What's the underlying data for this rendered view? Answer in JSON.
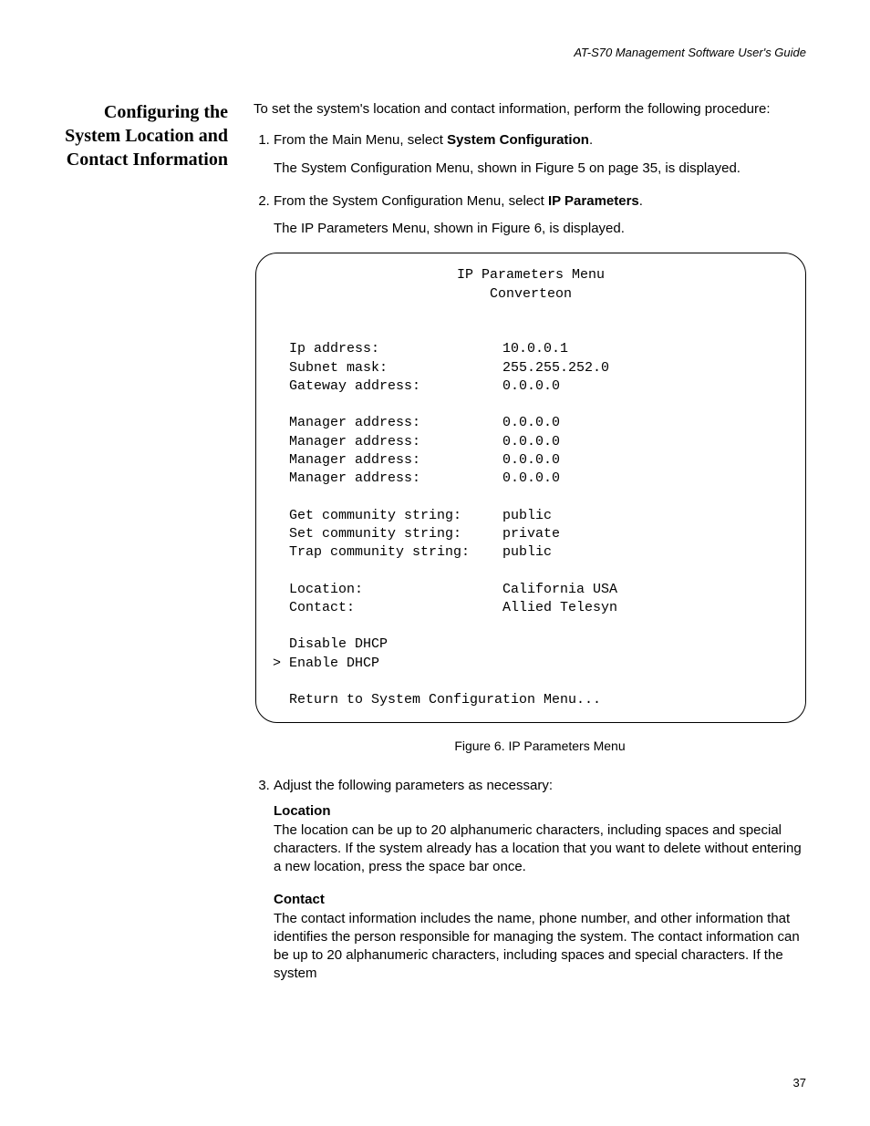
{
  "header": "AT-S70 Management Software User's Guide",
  "side_heading": "Configuring the System Location and Contact Information",
  "intro": "To set the system's location and contact information, perform the following procedure:",
  "steps": {
    "s1_pre": "From the Main Menu, select ",
    "s1_bold": "System Configuration",
    "s1_post": ".",
    "s1_detail": "The System Configuration Menu, shown in Figure 5 on page 35, is displayed.",
    "s2_pre": "From the System Configuration Menu, select ",
    "s2_bold": "IP Parameters",
    "s2_post": ".",
    "s2_detail": "The IP Parameters Menu, shown in Figure 6, is displayed.",
    "s3": "Adjust the following parameters as necessary:"
  },
  "terminal": {
    "title1": "IP Parameters Menu",
    "title2": "Converteon",
    "rows": [
      {
        "k": "Ip address:",
        "v": "10.0.0.1"
      },
      {
        "k": "Subnet mask:",
        "v": "255.255.252.0"
      },
      {
        "k": "Gateway address:",
        "v": "0.0.0.0"
      },
      {
        "k": "",
        "v": ""
      },
      {
        "k": "Manager address:",
        "v": "0.0.0.0"
      },
      {
        "k": "Manager address:",
        "v": "0.0.0.0"
      },
      {
        "k": "Manager address:",
        "v": "0.0.0.0"
      },
      {
        "k": "Manager address:",
        "v": "0.0.0.0"
      },
      {
        "k": "",
        "v": ""
      },
      {
        "k": "Get community string:",
        "v": "public"
      },
      {
        "k": "Set community string:",
        "v": "private"
      },
      {
        "k": "Trap community string:",
        "v": "public"
      },
      {
        "k": "",
        "v": ""
      },
      {
        "k": "Location:",
        "v": "California USA"
      },
      {
        "k": "Contact:",
        "v": "Allied Telesyn"
      }
    ],
    "dhcp_disable": "  Disable DHCP",
    "dhcp_enable": "> Enable DHCP",
    "return_line": "  Return to System Configuration Menu..."
  },
  "caption": "Figure 6. IP Parameters Menu",
  "params": {
    "location_title": "Location",
    "location_body": "The location can be up to 20 alphanumeric characters, including spaces and special characters. If the system already has a location that you want to delete without entering a new location, press the space bar once.",
    "contact_title": "Contact",
    "contact_body": "The contact information includes the name, phone number, and other information that identifies the person responsible for managing the system. The contact information can be up to 20 alphanumeric characters, including spaces and special characters. If the system"
  },
  "page_number": "37"
}
